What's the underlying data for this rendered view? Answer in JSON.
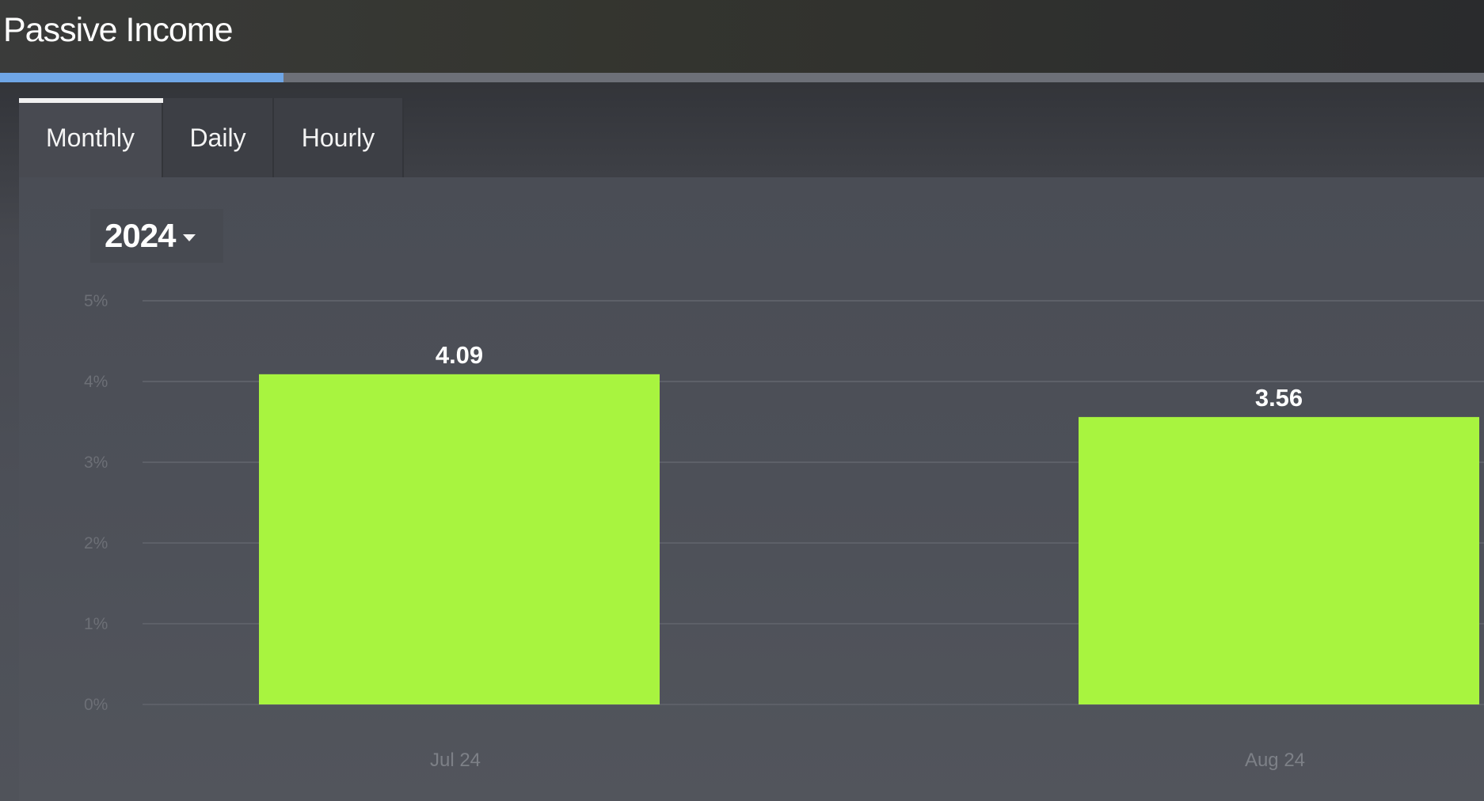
{
  "header": {
    "title": "Passive Income"
  },
  "tabs": [
    {
      "label": "Monthly",
      "active": true
    },
    {
      "label": "Daily",
      "active": false
    },
    {
      "label": "Hourly",
      "active": false
    }
  ],
  "year_select": {
    "value": "2024",
    "icon": "chevron-down-icon"
  },
  "colors": {
    "bar": "#a8f43f",
    "accent": "#6fa6e6",
    "gridline": "#5d6068"
  },
  "chart_data": {
    "type": "bar",
    "categories": [
      "Jul 24",
      "Aug 24"
    ],
    "values": [
      4.09,
      3.56
    ],
    "data_labels": [
      "4.09",
      "3.56"
    ],
    "y_ticks": [
      {
        "value": 0,
        "label": "0%"
      },
      {
        "value": 1,
        "label": "1%"
      },
      {
        "value": 2,
        "label": "2%"
      },
      {
        "value": 3,
        "label": "3%"
      },
      {
        "value": 4,
        "label": "4%"
      },
      {
        "value": 5,
        "label": "5%"
      }
    ],
    "ylim": [
      0,
      5
    ],
    "grid": true,
    "legend": "none"
  }
}
